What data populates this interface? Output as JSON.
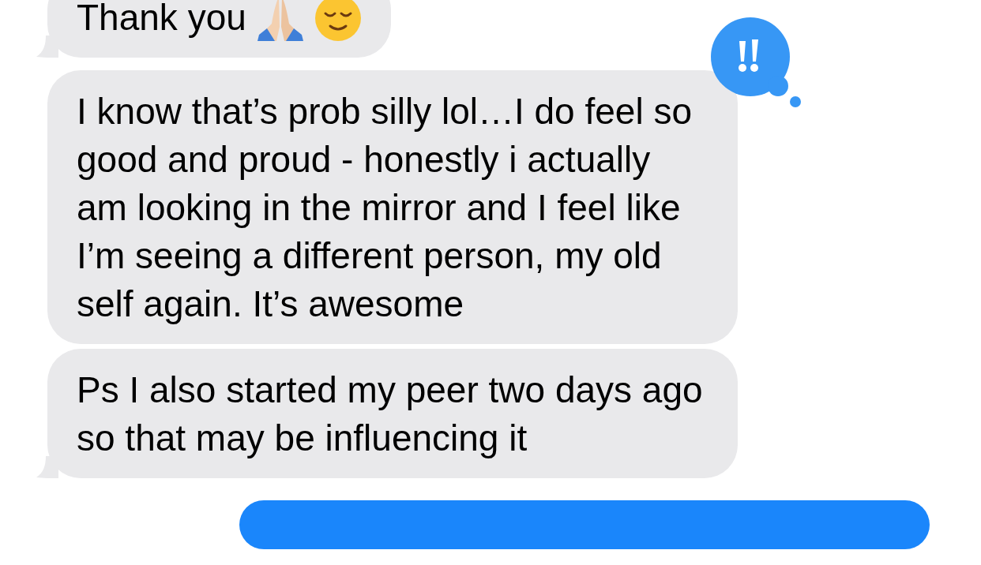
{
  "messages": [
    {
      "kind": "received",
      "text": "Thank you",
      "emoji": true,
      "tail": true,
      "tapback": false
    },
    {
      "kind": "received",
      "text": "I know that’s prob silly lol…I do feel so good and proud - honestly i actually am looking in the mirror and I feel like I’m seeing a different person, my old self again. It’s awesome",
      "emoji": false,
      "tail": false,
      "tapback": true
    },
    {
      "kind": "received",
      "text": "Ps I also started my peer two days ago so that may be influencing it",
      "emoji": false,
      "tail": true,
      "tapback": false
    },
    {
      "kind": "sent",
      "tail": false,
      "tapback": false
    }
  ]
}
